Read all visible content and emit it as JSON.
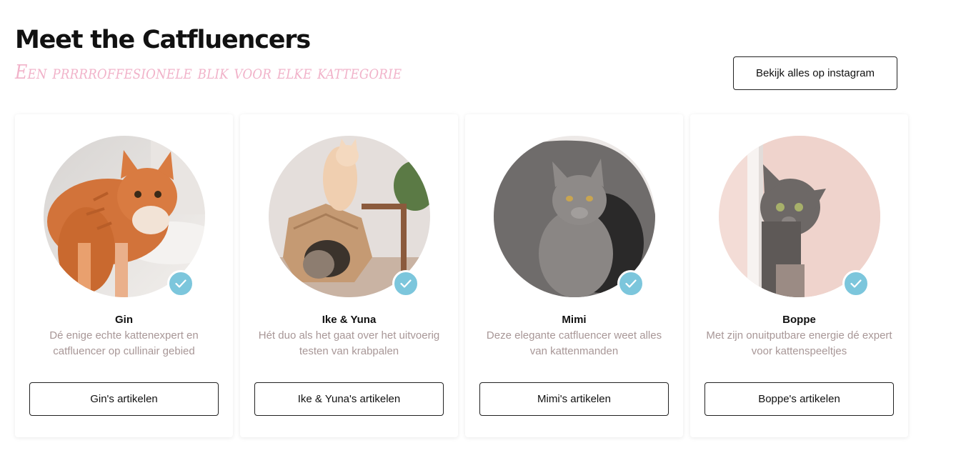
{
  "header": {
    "title": "Meet the Catfluencers",
    "subtitle": "Een prrrroffesionele blik voor elke kattegorie",
    "instagram_button": "Bekijk alles op instagram"
  },
  "colors": {
    "accent_pink": "#f1b2c9",
    "badge_blue": "#7cc6dc",
    "muted_text": "#a89797"
  },
  "cards": [
    {
      "name": "Gin",
      "description": "Dé enige echte kattenexpert en catfluencer op cullinair gebied",
      "button": "Gin's artikelen",
      "icon": "verified-check-icon"
    },
    {
      "name": "Ike & Yuna",
      "description": "Hét duo als het gaat over het uitvoerig testen van krabpalen",
      "button": "Ike & Yuna's artikelen",
      "icon": "verified-check-icon"
    },
    {
      "name": "Mimi",
      "description": "Deze elegante catfluencer weet alles van kattenmanden",
      "button": "Mimi's artikelen",
      "icon": "verified-check-icon"
    },
    {
      "name": "Boppe",
      "description": "Met zijn onuitputbare energie dé expert voor kattenspeeltjes",
      "button": "Boppe's artikelen",
      "icon": "verified-check-icon"
    }
  ]
}
